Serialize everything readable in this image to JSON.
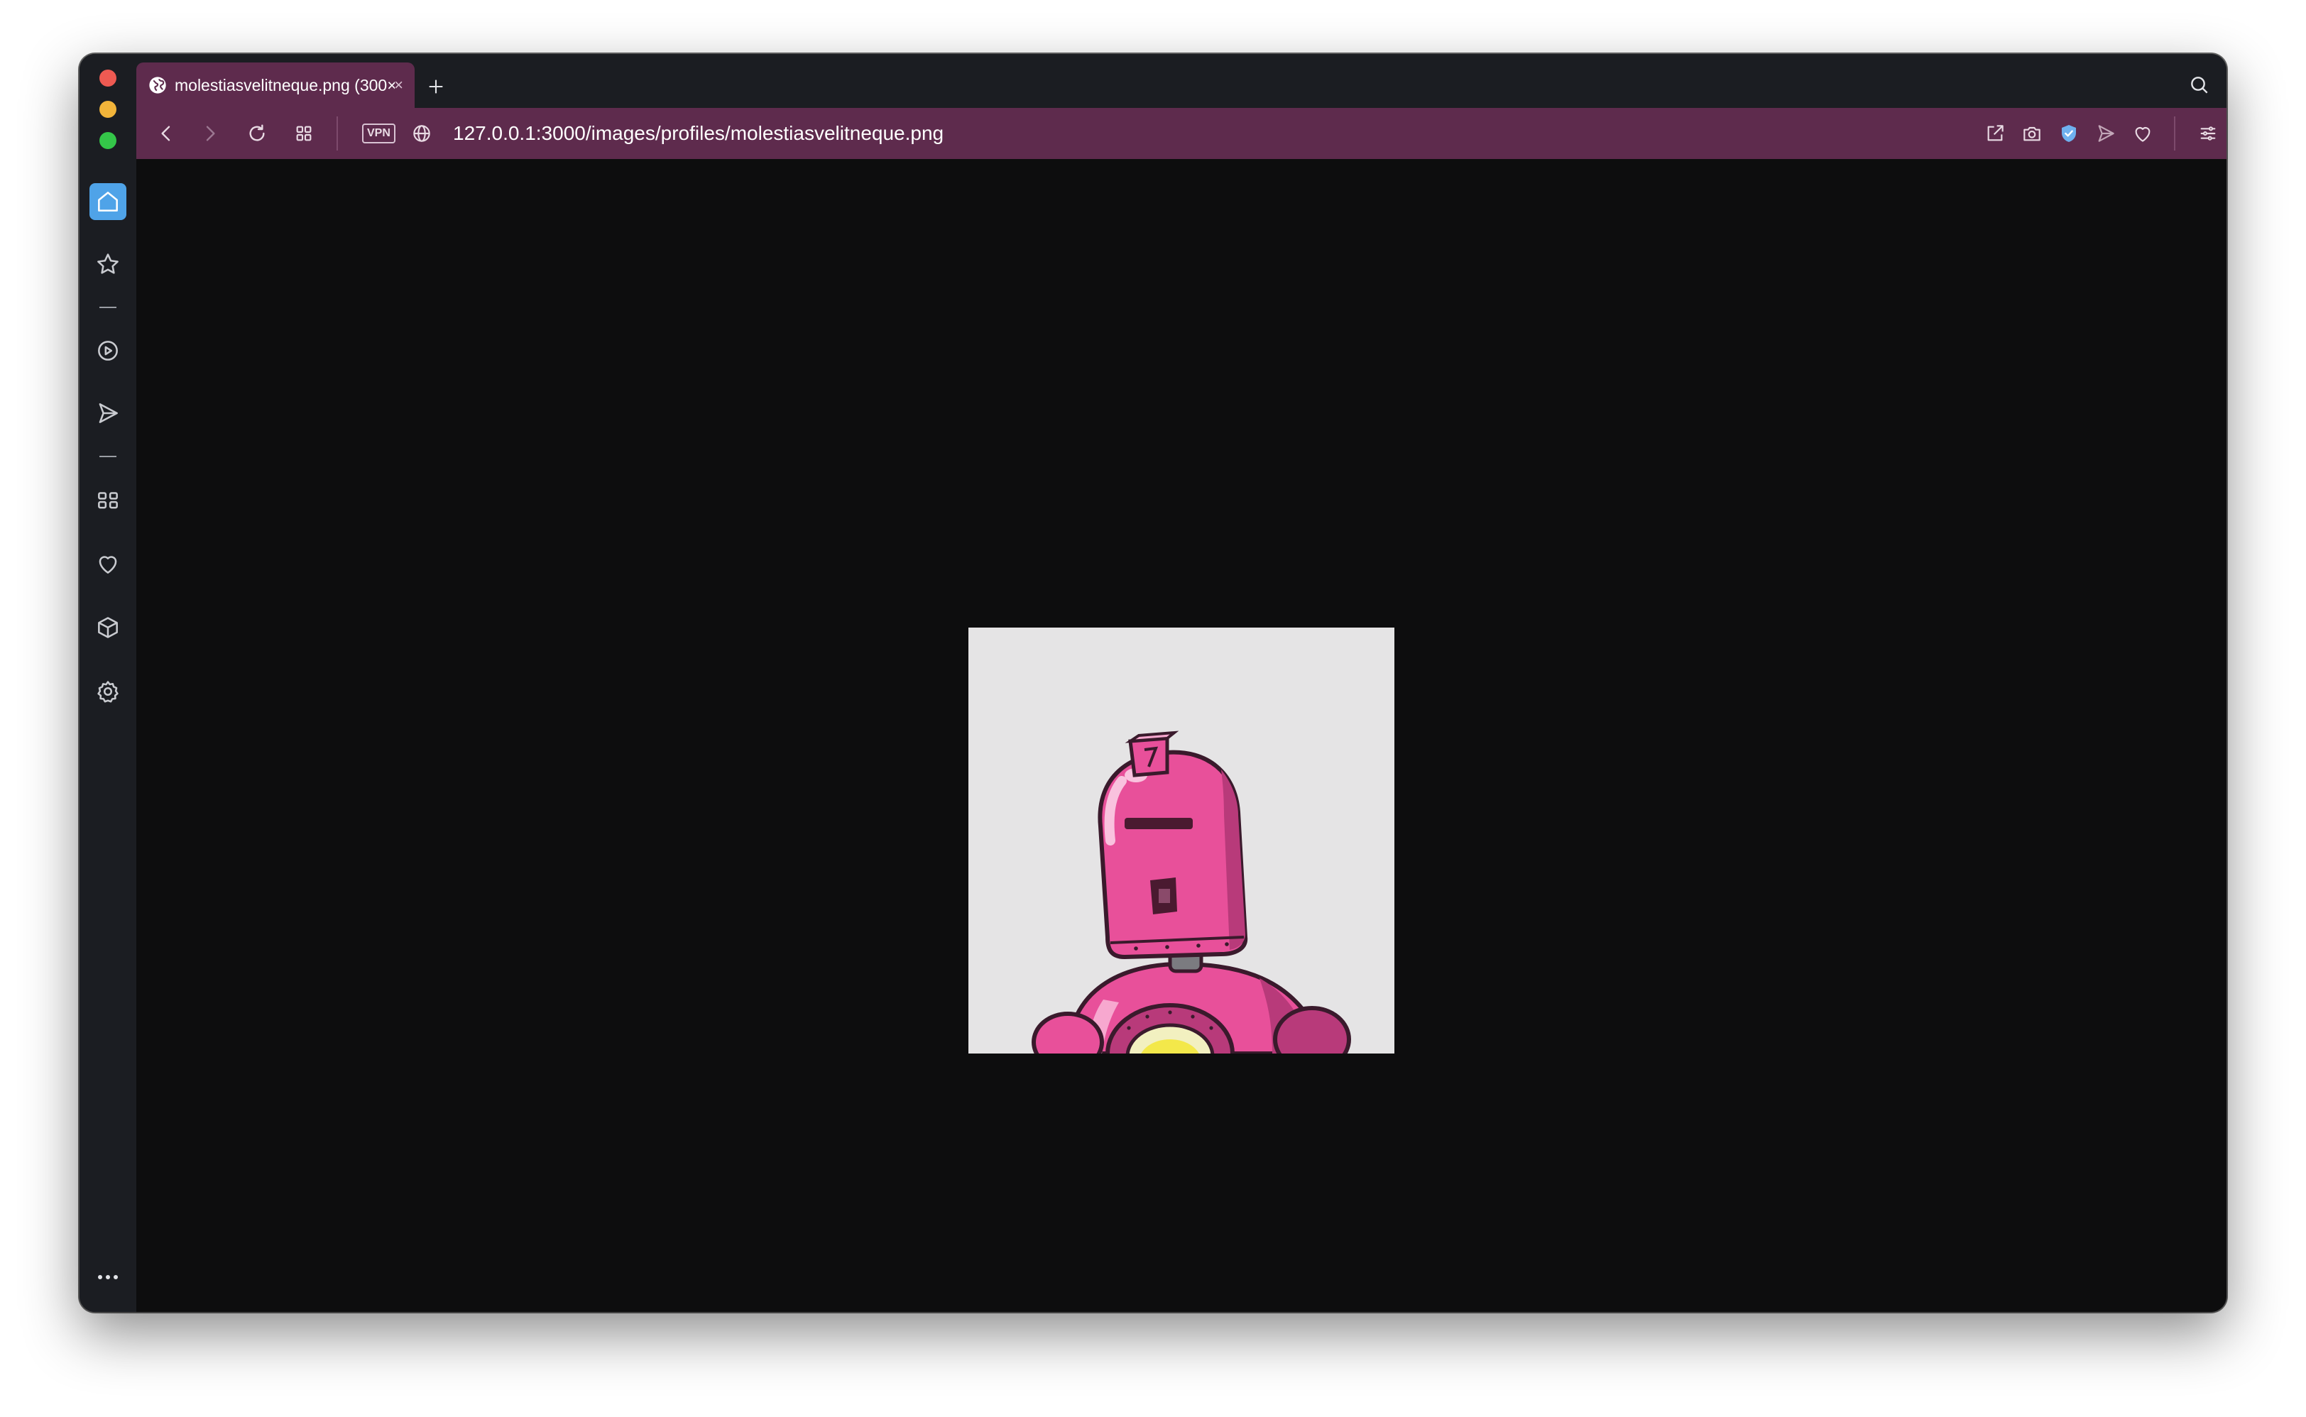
{
  "browser": {
    "tab": {
      "title": "molestiasvelitneque.png (300×",
      "close_glyph": "×",
      "favicon": "globe-icon"
    },
    "new_tab_glyph": "+",
    "url": "127.0.0.1:3000/images/profiles/molestiasvelitneque.png",
    "vpn_label": "VPN",
    "toolbar_icons": [
      "back-icon",
      "forward-icon",
      "reload-icon",
      "tabs-grid-icon",
      "globe-icon",
      "share-icon",
      "camera-icon",
      "shield-icon",
      "send-icon",
      "heart-icon",
      "menu-icon"
    ],
    "sidebar_icons": [
      "home-icon",
      "star-icon",
      "player-icon",
      "send-icon",
      "apps-icon",
      "heart-icon",
      "box-icon",
      "gear-icon",
      "more-icon"
    ],
    "colors": {
      "tab_bar": "#5e2b4d",
      "chrome": "#1b1d22",
      "content_bg": "#0d0d0e",
      "active_sidebar": "#4fa3e8",
      "image_bg": "#e5e4e5",
      "robot_pink": "#e8509a"
    }
  }
}
